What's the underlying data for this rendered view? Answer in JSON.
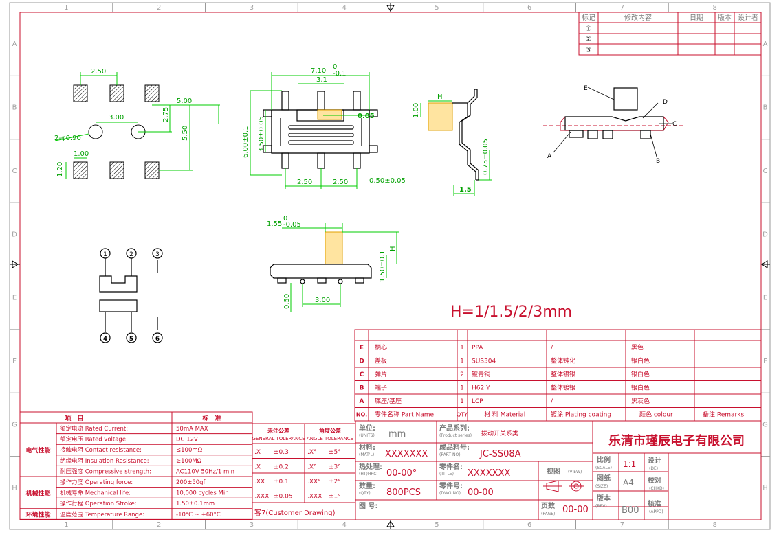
{
  "frame": {
    "col_labels": [
      "1",
      "2",
      "3",
      "4",
      "5",
      "6",
      "7",
      "8"
    ],
    "row_labels": [
      "A",
      "B",
      "C",
      "D",
      "E",
      "F",
      "G",
      "H"
    ]
  },
  "revision_table": {
    "headers": [
      "标记",
      "修改内容",
      "日期",
      "版本",
      "设计者"
    ],
    "marks": [
      "①",
      "②",
      "③"
    ]
  },
  "dims": {
    "footprint": {
      "pitch": "2.50",
      "hole_spacing": "3.00",
      "hole": "2-φ0.90",
      "pad_w": "1.00",
      "pad_h": "1.20",
      "d275": "2.75",
      "d500": "5.00",
      "d550": "5.50"
    },
    "front": {
      "overall": "7.10",
      "tol_top": "0",
      "tol_bot": "-0.1",
      "slot": "3.1",
      "d005": "0.05",
      "h600": "6.00±0.1",
      "h350": "3.50±0.05",
      "p1": "2.50",
      "p2": "2.50",
      "d050": "0.50±0.05"
    },
    "side": {
      "h": "H",
      "d100": "1.00",
      "d075": "0.75±0.05",
      "d15": "1.5"
    },
    "bottom": {
      "d155": "1.55",
      "tol_top": "0",
      "tol_bot": "-0.05",
      "h": "H",
      "h150": "1.50±0.1",
      "d050": "0.50",
      "d300": "3.00"
    }
  },
  "exploded_labels": [
    "E",
    "D",
    "C",
    "A",
    "B"
  ],
  "schematic": {
    "pins_top": [
      "1",
      "2",
      "3"
    ],
    "pins_bottom": [
      "4",
      "5",
      "6"
    ]
  },
  "h_spec": "H=1/1.5/2/3mm",
  "bom": {
    "rows": [
      {
        "id": "E",
        "name": "柄心",
        "qty": "1",
        "material": "PPA",
        "plating": "/",
        "colour": "黑色",
        "remark": ""
      },
      {
        "id": "D",
        "name": "盖板",
        "qty": "1",
        "material": "SUS304",
        "plating": "整体钝化",
        "colour": "银白色",
        "remark": ""
      },
      {
        "id": "C",
        "name": "弹片",
        "qty": "2",
        "material": "铍青铜",
        "plating": "整体镀银",
        "colour": "银白色",
        "remark": ""
      },
      {
        "id": "B",
        "name": "端子",
        "qty": "1",
        "material": "H62 Y",
        "plating": "整体镀银",
        "colour": "银白色",
        "remark": ""
      },
      {
        "id": "A",
        "name": "底座/基座",
        "qty": "1",
        "material": "LCP",
        "plating": "/",
        "colour": "黑灰色",
        "remark": ""
      }
    ],
    "headers": {
      "no": "NO.",
      "name": "零件名称 Part Name",
      "qty": "QTY",
      "material": "材 料 Material",
      "plating": "镀涂 Plating coating",
      "colour": "颜色 colour",
      "remark": "备注 Remarks"
    }
  },
  "spec": {
    "header_item": "项　目",
    "header_std": "标　准",
    "groups": [
      {
        "label": "电气性能",
        "rows": [
          {
            "item": "额定电流 Rated Current:",
            "value": "50mA MAX"
          },
          {
            "item": "额定电压 Rated voltage:",
            "value": "DC 12V"
          },
          {
            "item": "接触电阻 Contact resistance:",
            "value": "≤100mΩ"
          },
          {
            "item": "绝缘电阻 Insulation Resistance:",
            "value": "≥100MΩ"
          },
          {
            "item": "耐压强度 Compressive strength:",
            "value": "AC110V 50Hz/1 min"
          }
        ]
      },
      {
        "label": "机械性能",
        "rows": [
          {
            "item": "操作力度 Operating force:",
            "value": "200±50gf"
          },
          {
            "item": "机械寿命 Mechanical life:",
            "value": "10,000 cycles Min"
          },
          {
            "item": "操作行程 Operation Stroke:",
            "value": "1.50±0.1mm"
          }
        ]
      },
      {
        "label": "环境性能",
        "rows": [
          {
            "item": "温度范围 Temperature Range:",
            "value": "-10°C ~ +60°C"
          }
        ]
      }
    ]
  },
  "tolerance": {
    "general_cn": "未注公差",
    "general_en": "GENERAL TOLERANCE",
    "angle_cn": "角度公差",
    "angle_en": "ANGLE TOLERANCE",
    "rows": [
      {
        "g": ".X",
        "gv": "±0.3",
        "a": ".X°",
        "av": "±5°"
      },
      {
        "g": ".X",
        "gv": "±0.2",
        "a": ".X°",
        "av": "±3°"
      },
      {
        "g": ".XX",
        "gv": "±0.1",
        "a": ".XX°",
        "av": "±2°"
      },
      {
        "g": ".XXX",
        "gv": "±0.05",
        "a": ".XXX",
        "av": "±1°"
      }
    ],
    "customer": "客7(Customer Drawing)"
  },
  "title_block": {
    "units_label": "单位:",
    "units_sub": "(UNITS)",
    "units_value": "mm",
    "series_label": "产品系列:",
    "series_sub": "(Product series)",
    "series_value": "拨动开关系类",
    "material_label": "材料:",
    "material_sub": "(MAT'L)",
    "material_value": "XXXXXXX",
    "part_label": "成品料号:",
    "part_sub": "(PART NO)",
    "part_value": "JC-SS08A",
    "heat_label": "热处理:",
    "heat_sub": "(HT)HRC:",
    "heat_value": "00-00°",
    "name_label": "零件名:",
    "name_sub": "(TITLE)",
    "name_value": "XXXXXXX",
    "qty_label": "数量:",
    "qty_sub": "(QTY)",
    "qty_value": "800PCS",
    "dwg_label": "零件号:",
    "dwg_sub": "(DWG NO)",
    "dwg_value": "00-00",
    "figure_label": "图 号:",
    "view_label": "视图",
    "view_sub": "(VIEW)",
    "page_label": "页数",
    "page_sub": "(PAGE)",
    "page_value": "00-00",
    "company": "乐清市瑾辰电子有限公司",
    "scale_label": "比例",
    "scale_sub": "(SCALE)",
    "scale_value": "1:1",
    "size_label": "图纸",
    "size_sub": "(SIZE)",
    "size_value": "A4",
    "rev_label": "版本",
    "rev_sub": "(REV)",
    "rev_value": "B00",
    "design_label": "设计",
    "design_sub": "(DE)",
    "check_label": "校对",
    "check_sub": "(CHKD)",
    "approve_label": "核准",
    "approve_sub": "(APPD)"
  }
}
